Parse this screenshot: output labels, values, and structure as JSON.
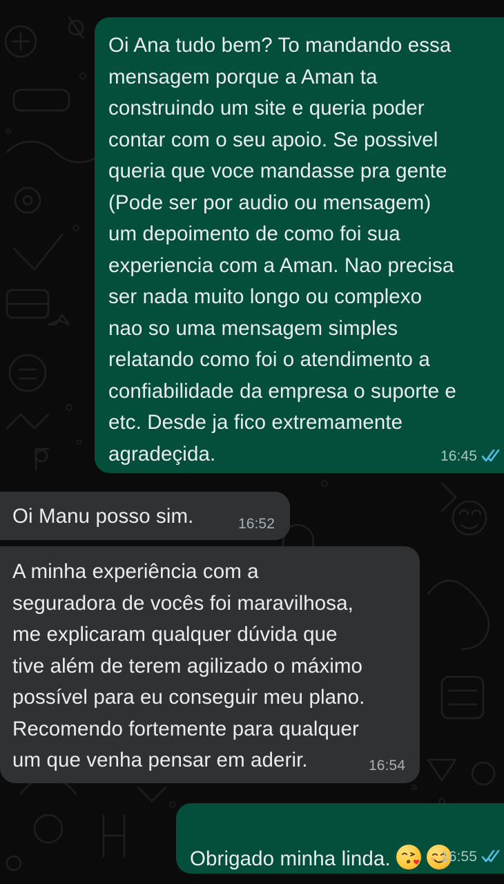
{
  "messages": [
    {
      "direction": "outgoing",
      "text": "Oi Ana tudo bem? To mandando essa\nmensagem porque a Aman ta\nconstruindo um site e queria poder\ncontar com o seu apoio. Se possivel\nqueria que voce mandasse pra gente\n(Pode ser por audio ou mensagem)\num depoimento de como foi sua\nexperiencia com a Aman. Nao precisa\nser nada muito longo ou complexo\nnao so uma mensagem simples\nrelatando como foi o atendimento a\nconfiabilidade da empresa o suporte e\netc. Desde ja fico extremamente\nagradeçida.",
      "time": "16:45",
      "status": "read"
    },
    {
      "direction": "incoming",
      "text": "Oi Manu posso sim.",
      "time": "16:52"
    },
    {
      "direction": "incoming",
      "text": "A minha experiência com a\nseguradora de vocês foi maravilhosa,\nme explicaram qualquer dúvida que\ntive além de terem agilizado o máximo\npossível para eu conseguir meu plano.\nRecomendo fortemente para qualquer\num que venha pensar em aderir.",
      "time": "16:54"
    },
    {
      "direction": "outgoing",
      "text": "Obrigado minha linda.",
      "emojis": [
        "face-blowing-a-kiss-emoji",
        "smiling-face-emoji"
      ],
      "time": "16:55",
      "status": "read"
    }
  ],
  "colors": {
    "background": "#0b0b0b",
    "outgoing_bubble": "#044f3b",
    "incoming_bubble": "#2f3133",
    "text": "#e9edef",
    "read_check": "#53bdeb"
  }
}
